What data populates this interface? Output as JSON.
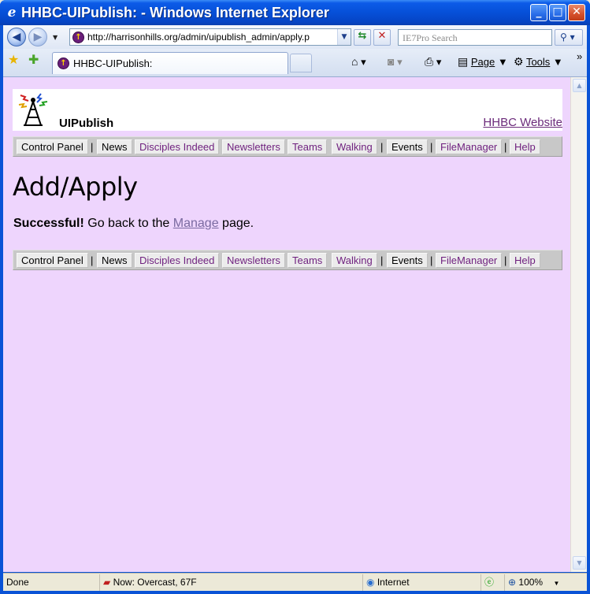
{
  "window": {
    "title": "HHBC-UIPublish: - Windows Internet Explorer",
    "minimize": "_",
    "maximize": "□",
    "close": "✕"
  },
  "browser": {
    "address_url": "http://harrisonhills.org/admin/uipublish_admin/apply.p",
    "search_placeholder": "IE7Pro Search",
    "tab_title": "HHBC-UIPublish:",
    "commands": {
      "page": "Page",
      "tools": "Tools"
    },
    "icons": [
      "back-icon",
      "forward-icon",
      "refresh-icon",
      "stop-icon",
      "search-icon",
      "favorites-star-icon",
      "add-favorites-icon",
      "home-icon",
      "feeds-icon",
      "print-icon",
      "page-icon",
      "tools-gear-icon"
    ]
  },
  "site": {
    "brand": "UIPublish",
    "external_link": "HHBC Website",
    "nav": [
      {
        "label": "Control Panel",
        "dim": true
      },
      {
        "label": "News",
        "dim": true
      },
      {
        "label": "Disciples Indeed",
        "dim": false
      },
      {
        "label": "Newsletters",
        "dim": false
      },
      {
        "label": "Teams",
        "dim": false
      },
      {
        "label": "Walking",
        "dim": false
      },
      {
        "label": "Events",
        "dim": true
      },
      {
        "label": "FileManager",
        "dim": false
      },
      {
        "label": "Help",
        "dim": false
      }
    ],
    "separator": "|"
  },
  "main": {
    "title": "Add/Apply",
    "message_bold": "Successful!",
    "message_pre": " Go back to the ",
    "message_link": "Manage",
    "message_post": " page."
  },
  "status": {
    "text": "Done",
    "weather": "Now: Overcast, 67F",
    "zone": "Internet",
    "zoom": "100%"
  },
  "colors": {
    "page_background": "#eed5fd",
    "link_visited": "#6b2a7a",
    "titlebar": "#0650d8"
  }
}
